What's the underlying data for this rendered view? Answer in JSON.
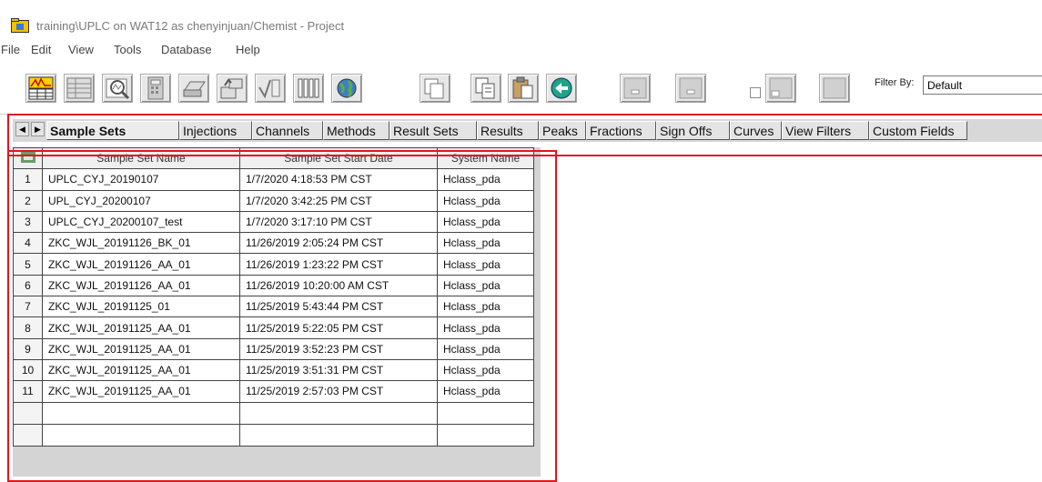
{
  "window": {
    "title": "training\\UPLC on WAT12 as chenyinjuan/Chemist - Project"
  },
  "menu": [
    "File",
    "Edit",
    "View",
    "Tools",
    "Database",
    "Help"
  ],
  "toolbar": {
    "filter_label": "Filter By:",
    "filter_value": "Default"
  },
  "tabs": [
    "Sample Sets",
    "Injections",
    "Channels",
    "Methods",
    "Result Sets",
    "Results",
    "Peaks",
    "Fractions",
    "Sign Offs",
    "Curves",
    "View Filters",
    "Custom Fields"
  ],
  "table": {
    "columns": [
      "Sample Set Name",
      "Sample Set Start Date",
      "System Name"
    ],
    "rows": [
      {
        "n": "1",
        "name": "UPLC_CYJ_20190107",
        "date": "1/7/2020 4:18:53 PM CST",
        "system": "Hclass_pda"
      },
      {
        "n": "2",
        "name": "UPL_CYJ_20200107",
        "date": "1/7/2020 3:42:25 PM CST",
        "system": "Hclass_pda"
      },
      {
        "n": "3",
        "name": "UPLC_CYJ_20200107_test",
        "date": "1/7/2020 3:17:10 PM CST",
        "system": "Hclass_pda"
      },
      {
        "n": "4",
        "name": "ZKC_WJL_20191126_BK_01",
        "date": "11/26/2019 2:05:24 PM CST",
        "system": "Hclass_pda"
      },
      {
        "n": "5",
        "name": "ZKC_WJL_20191126_AA_01",
        "date": "11/26/2019 1:23:22 PM CST",
        "system": "Hclass_pda"
      },
      {
        "n": "6",
        "name": "ZKC_WJL_20191126_AA_01",
        "date": "11/26/2019 10:20:00 AM CST",
        "system": "Hclass_pda"
      },
      {
        "n": "7",
        "name": "ZKC_WJL_20191125_01",
        "date": "11/25/2019 5:43:44 PM CST",
        "system": "Hclass_pda"
      },
      {
        "n": "8",
        "name": "ZKC_WJL_20191125_AA_01",
        "date": "11/25/2019 5:22:05 PM CST",
        "system": "Hclass_pda"
      },
      {
        "n": "9",
        "name": "ZKC_WJL_20191125_AA_01",
        "date": "11/25/2019 3:52:23 PM CST",
        "system": "Hclass_pda"
      },
      {
        "n": "10",
        "name": "ZKC_WJL_20191125_AA_01",
        "date": "11/25/2019 3:51:31 PM CST",
        "system": "Hclass_pda"
      },
      {
        "n": "11",
        "name": "ZKC_WJL_20191125_AA_01",
        "date": "11/25/2019 2:57:03 PM CST",
        "system": "Hclass_pda"
      }
    ]
  },
  "colors": {
    "highlight": "#e0161e",
    "folder_icon": "#f2c200"
  }
}
